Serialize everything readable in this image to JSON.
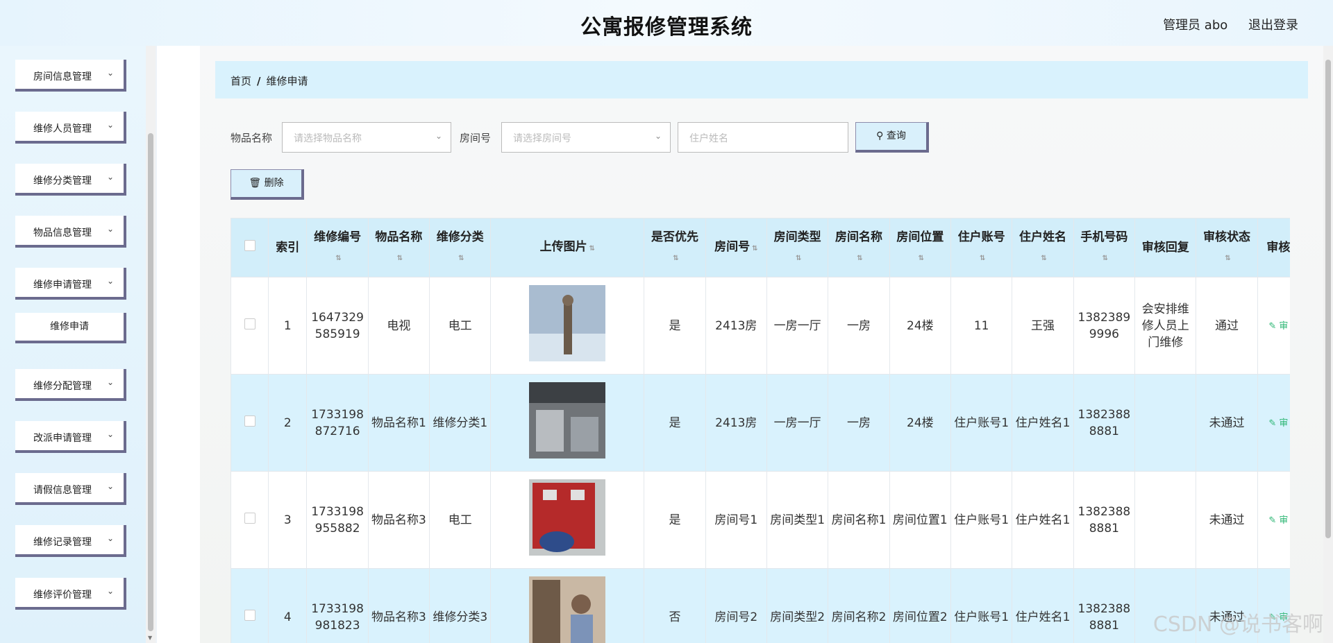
{
  "header": {
    "title": "公寓报修管理系统",
    "user": "管理员 abo",
    "logout": "退出登录"
  },
  "sidebar": {
    "items": [
      {
        "label": "房间信息管理"
      },
      {
        "label": "维修人员管理"
      },
      {
        "label": "维修分类管理"
      },
      {
        "label": "物品信息管理"
      },
      {
        "label": "维修申请管理"
      },
      {
        "label": "维修分配管理"
      },
      {
        "label": "改派申请管理"
      },
      {
        "label": "请假信息管理"
      },
      {
        "label": "维修记录管理"
      },
      {
        "label": "维修评价管理"
      }
    ],
    "sub_item": "维修申请"
  },
  "breadcrumb": {
    "home": "首页",
    "sep": "/",
    "current": "维修申请"
  },
  "filters": {
    "item_label": "物品名称",
    "item_placeholder": "请选择物品名称",
    "room_label": "房间号",
    "room_placeholder": "请选择房间号",
    "name_placeholder": "住户姓名",
    "search_button": "查询",
    "delete_button": "删除"
  },
  "table": {
    "headers": [
      "索引",
      "维修编号",
      "物品名称",
      "维修分类",
      "上传图片",
      "是否优先",
      "房间号",
      "房间类型",
      "房间名称",
      "房间位置",
      "住户账号",
      "住户姓名",
      "手机号码",
      "审核回复",
      "审核状态",
      "审核"
    ],
    "rows": [
      {
        "index": "1",
        "code": "1647329585919",
        "item": "电视",
        "category": "电工",
        "priority": "是",
        "room_no": "2413房",
        "room_type": "一房一厅",
        "room_name": "一房",
        "room_pos": "24楼",
        "account": "11",
        "name": "王强",
        "phone": "13823899996",
        "reply": "会安排维修人员上门维修",
        "status": "通过",
        "action": "审"
      },
      {
        "index": "2",
        "code": "1733198872716",
        "item": "物品名称1",
        "category": "维修分类1",
        "priority": "是",
        "room_no": "2413房",
        "room_type": "一房一厅",
        "room_name": "一房",
        "room_pos": "24楼",
        "account": "住户账号1",
        "name": "住户姓名1",
        "phone": "13823888881",
        "reply": "",
        "status": "未通过",
        "action": "审"
      },
      {
        "index": "3",
        "code": "1733198955882",
        "item": "物品名称3",
        "category": "电工",
        "priority": "是",
        "room_no": "房间号1",
        "room_type": "房间类型1",
        "room_name": "房间名称1",
        "room_pos": "房间位置1",
        "account": "住户账号1",
        "name": "住户姓名1",
        "phone": "13823888881",
        "reply": "",
        "status": "未通过",
        "action": "审"
      },
      {
        "index": "4",
        "code": "1733198981823",
        "item": "物品名称3",
        "category": "维修分类3",
        "priority": "否",
        "room_no": "房间号2",
        "room_type": "房间类型2",
        "room_name": "房间名称2",
        "room_pos": "房间位置2",
        "account": "住户账号1",
        "name": "住户姓名1",
        "phone": "13823888881",
        "reply": "",
        "status": "未通过",
        "action": "审"
      }
    ]
  },
  "watermark": "CSDN @说书客啊",
  "icons": {
    "search": "search-icon",
    "delete": "trash-icon",
    "edit": "edit-icon",
    "chevron": "chevron-down-icon"
  }
}
